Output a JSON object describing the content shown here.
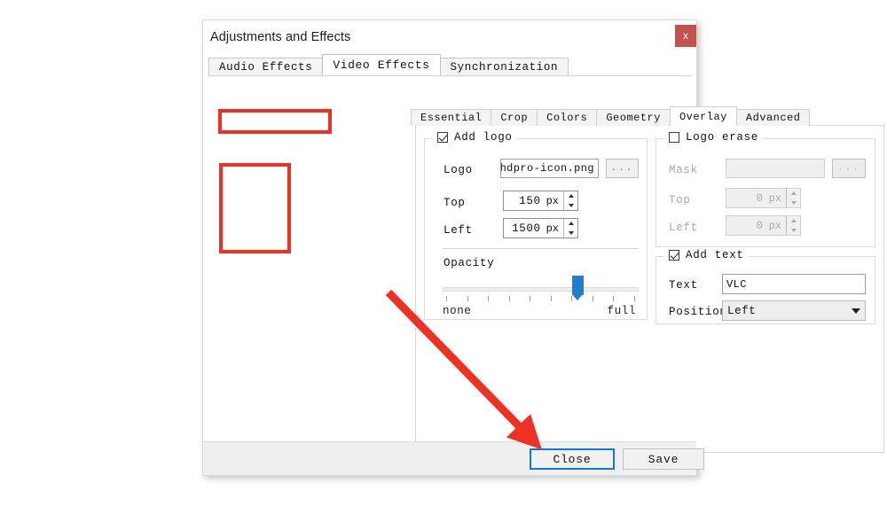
{
  "window": {
    "title": "Adjustments and Effects",
    "close_button": "x"
  },
  "outer_tabs": [
    {
      "label": "Audio Effects",
      "active": false
    },
    {
      "label": "Video Effects",
      "active": true
    },
    {
      "label": "Synchronization",
      "active": false
    }
  ],
  "inner_tabs": [
    {
      "label": "Essential",
      "active": false
    },
    {
      "label": "Crop",
      "active": false
    },
    {
      "label": "Colors",
      "active": false
    },
    {
      "label": "Geometry",
      "active": false
    },
    {
      "label": "Overlay",
      "active": true
    },
    {
      "label": "Advanced",
      "active": false
    }
  ],
  "add_logo": {
    "group_title": "Add logo",
    "checked": true,
    "logo_label": "Logo",
    "logo_value": "\\hdpro-icon.png",
    "browse_label": "...",
    "top_label": "Top",
    "top_value": "150",
    "top_unit": "px",
    "left_label": "Left",
    "left_value": "1500",
    "left_unit": "px",
    "opacity_label": "Opacity",
    "opacity_min_label": "none",
    "opacity_max_label": "full",
    "opacity_percent": 70,
    "tick_count": 10
  },
  "logo_erase": {
    "group_title": "Logo erase",
    "checked": false,
    "enabled": false,
    "mask_label": "Mask",
    "mask_value": "",
    "browse_label": "...",
    "top_label": "Top",
    "top_value": "0",
    "top_unit": "px",
    "left_label": "Left",
    "left_value": "0",
    "left_unit": "px"
  },
  "add_text": {
    "group_title": "Add text",
    "checked": true,
    "text_label": "Text",
    "text_value": "VLC",
    "position_label": "Position",
    "position_value": "Left"
  },
  "footer": {
    "close_label": "Close",
    "save_label": "Save"
  },
  "annotations": {
    "accent_color": "#ef3124",
    "highlight_boxes": [
      {
        "name": "add-logo-highlight"
      },
      {
        "name": "position-fields-highlight"
      }
    ],
    "arrow": {
      "name": "pointer-arrow-to-close"
    }
  }
}
